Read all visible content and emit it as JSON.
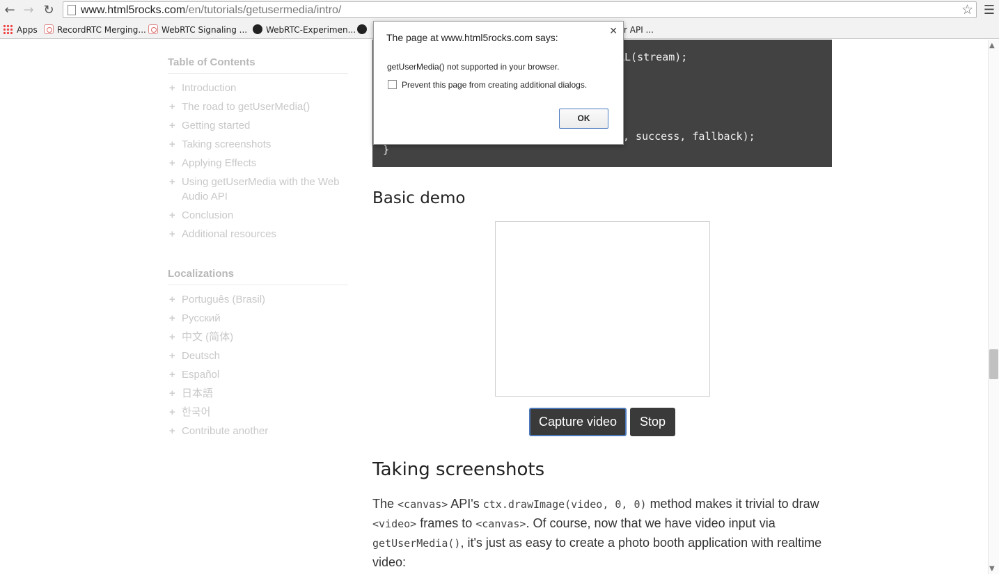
{
  "browser": {
    "url_host": "www.html5rocks.com",
    "url_path": "/en/tutorials/getusermedia/intro/",
    "bookmarks": [
      "Apps",
      "RecordRTC Merging...",
      "WebRTC Signaling ...",
      "WebRTC-Experimen...",
      "r API ..."
    ]
  },
  "toc": {
    "title": "Table of Contents",
    "items": [
      "Introduction",
      "The road to getUserMedia()",
      "Getting started",
      "Taking screenshots",
      "Applying Effects",
      "Using getUserMedia with the Web Audio API",
      "Conclusion",
      "Additional resources"
    ]
  },
  "localizations": {
    "title": "Localizations",
    "items": [
      "Português (Brasil)",
      "Русский",
      "中文 (简体)",
      "Deutsch",
      "Español",
      "日本語",
      "한국어",
      "Contribute another"
    ]
  },
  "code": {
    "line1": "RL(stream);",
    "line2": ", success, fallback);",
    "line3": "}"
  },
  "demo": {
    "heading": "Basic demo",
    "capture_label": "Capture video",
    "stop_label": "Stop"
  },
  "screenshots": {
    "heading": "Taking screenshots",
    "p1": "The ",
    "c1": "<canvas>",
    "p2": " API's ",
    "c2": "ctx.drawImage(video, 0, 0)",
    "p3": " method makes it trivial to draw ",
    "c3": "<video>",
    "p4": " frames to ",
    "c4": "<canvas>",
    "p5": ". Of course, now that we have video input via ",
    "c5": "getUserMedia()",
    "p6": ", it's just as easy to create a photo booth application with realtime video:"
  },
  "dialog": {
    "title": "The page at www.html5rocks.com says:",
    "message": "getUserMedia() not supported in your browser.",
    "checkbox_label": "Prevent this page from creating additional dialogs.",
    "ok_label": "OK"
  }
}
